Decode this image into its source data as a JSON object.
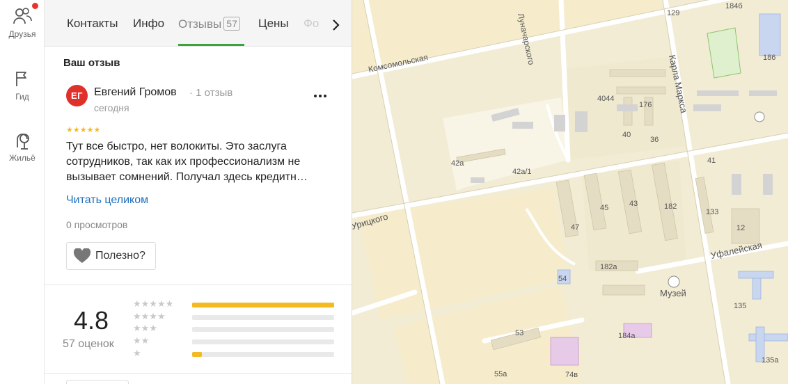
{
  "rail": {
    "items": [
      {
        "label": "Друзья",
        "icon": "friends-icon"
      },
      {
        "label": "Гид",
        "icon": "flag-icon"
      },
      {
        "label": "Жильё",
        "icon": "housing-icon"
      }
    ]
  },
  "tabs": {
    "contacts": "Контакты",
    "info": "Инфо",
    "reviews": "Отзывы",
    "reviews_count": "57",
    "prices": "Цены",
    "photos": "Фо"
  },
  "review": {
    "section_title": "Ваш отзыв",
    "avatar_initials": "ЕГ",
    "author": "Евгений Громов",
    "author_reviews": "1 отзыв",
    "date": "сегодня",
    "stars": 5,
    "text": "Тут все быстро, нет волокиты. Это заслуга сотрудников, так как их профессионализм не вызывает сомнений. Получал здесь кредитн…",
    "read_more": "Читать целиком",
    "views": "0 просмотров",
    "useful_label": "Полезно?"
  },
  "rating": {
    "value": "4.8",
    "count": "57 оценок",
    "distribution": [
      {
        "stars": 5,
        "fraction": 1.0
      },
      {
        "stars": 4,
        "fraction": 0.0
      },
      {
        "stars": 3,
        "fraction": 0.0
      },
      {
        "stars": 2,
        "fraction": 0.0
      },
      {
        "stars": 1,
        "fraction": 0.07
      }
    ]
  },
  "colors": {
    "accent_green": "#3aa43a",
    "star_yellow": "#f5b921",
    "avatar_red": "#e0302a",
    "link_blue": "#1e6fbf"
  },
  "map": {
    "streets": [
      "Комсомольская",
      "Луначарского",
      "Карла Маркса",
      "Урицкого",
      "Уфалейская"
    ],
    "buildings": [
      "129",
      "184б",
      "186",
      "4044",
      "176",
      "40",
      "36",
      "42а",
      "42а/1",
      "41",
      "45",
      "43",
      "182",
      "133",
      "47",
      "12",
      "182а",
      "54",
      "135",
      "Музей",
      "53",
      "184а",
      "55а",
      "74в",
      "135а"
    ]
  }
}
